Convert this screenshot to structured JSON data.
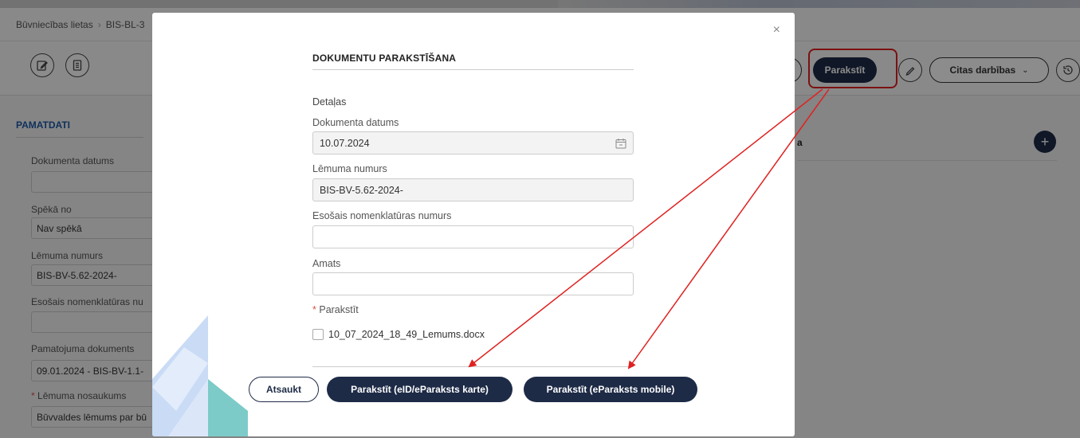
{
  "breadcrumb": {
    "item1": "Būvniecības lietas",
    "separator": "›",
    "item2": "BIS-BL-3"
  },
  "toolbar": {
    "sign_label": "Parakstīt",
    "other_actions_label": "Citas darbības",
    "edit_icon": "edit-icon",
    "history_icon": "history-icon"
  },
  "bg_form": {
    "section_title": "PAMATDATI",
    "fields": [
      {
        "label": "Dokumenta datums",
        "value": ""
      },
      {
        "label": "Spēkā no",
        "value": "Nav spēkā"
      },
      {
        "label": "Lēmuma numurs",
        "value": "BIS-BV-5.62-2024-"
      },
      {
        "label": "Esošais nomenklatūras nu",
        "value": ""
      },
      {
        "label": "Pamatojuma dokuments",
        "value": "09.01.2024 - BIS-BV-1.1-"
      },
      {
        "label": "Lēmuma nosaukums",
        "value": "Būvvaldes lēmums par bū"
      }
    ],
    "required_mark": "*",
    "right_panel_text": "a"
  },
  "modal": {
    "title": "DOKUMENTU PARAKSTĪŠANA",
    "close_symbol": "×",
    "section_label": "Detaļas",
    "date_label": "Dokumenta datums",
    "date_value": "10.07.2024",
    "decision_number_label": "Lēmuma numurs",
    "decision_number_value": "BIS-BV-5.62-2024-",
    "nomenclature_label": "Esošais nomenklatūras numurs",
    "nomenclature_value": "",
    "position_label": "Amats",
    "position_value": "",
    "sign_label": "Parakstīt",
    "required_mark": "*",
    "file_name": "10_07_2024_18_49_Lemums.docx",
    "file_checked": false,
    "cancel_label": "Atsaukt",
    "sign_card_label": "Parakstīt (eID/eParaksts karte)",
    "sign_mobile_label": "Parakstīt (eParaksts mobile)"
  },
  "colors": {
    "primary": "#1e2b47",
    "accent_blue": "#1e5aa8",
    "annotation_red": "#e02020"
  }
}
